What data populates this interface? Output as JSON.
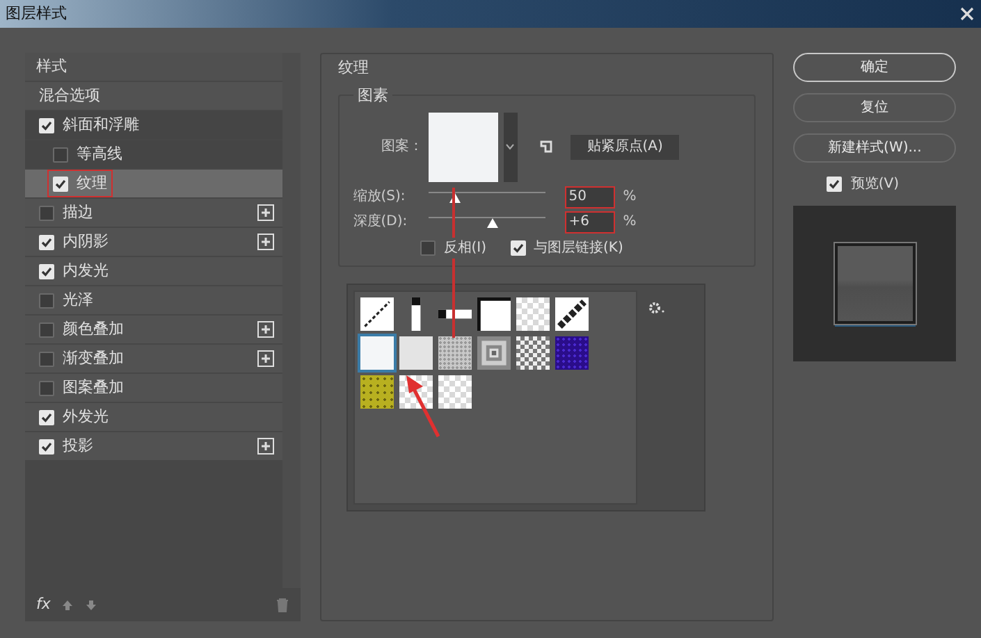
{
  "window": {
    "title": "图层样式"
  },
  "styles_panel": {
    "heading": "样式",
    "items": [
      {
        "kind": "option",
        "label": "混合选项",
        "selected": false,
        "highlighted": false
      },
      {
        "kind": "effect",
        "label": "斜面和浮雕",
        "checked": true,
        "has_add": false,
        "selected": false,
        "highlighted": false,
        "children": [
          {
            "kind": "effect",
            "label": "等高线",
            "checked": false,
            "has_add": false,
            "selected": false,
            "highlighted": false
          },
          {
            "kind": "effect",
            "label": "纹理",
            "checked": true,
            "has_add": false,
            "selected": true,
            "highlighted": true
          }
        ]
      },
      {
        "kind": "effect",
        "label": "描边",
        "checked": false,
        "has_add": true,
        "selected": false,
        "highlighted": false
      },
      {
        "kind": "effect",
        "label": "内阴影",
        "checked": true,
        "has_add": true,
        "selected": false,
        "highlighted": false
      },
      {
        "kind": "effect",
        "label": "内发光",
        "checked": true,
        "has_add": false,
        "selected": false,
        "highlighted": false
      },
      {
        "kind": "effect",
        "label": "光泽",
        "checked": false,
        "has_add": false,
        "selected": false,
        "highlighted": false
      },
      {
        "kind": "effect",
        "label": "颜色叠加",
        "checked": false,
        "has_add": true,
        "selected": false,
        "highlighted": false
      },
      {
        "kind": "effect",
        "label": "渐变叠加",
        "checked": false,
        "has_add": true,
        "selected": false,
        "highlighted": false
      },
      {
        "kind": "effect",
        "label": "图案叠加",
        "checked": false,
        "has_add": false,
        "selected": false,
        "highlighted": false
      },
      {
        "kind": "effect",
        "label": "外发光",
        "checked": true,
        "has_add": false,
        "selected": false,
        "highlighted": false
      },
      {
        "kind": "effect",
        "label": "投影",
        "checked": true,
        "has_add": true,
        "selected": false,
        "highlighted": false
      }
    ]
  },
  "texture": {
    "title": "纹理",
    "group_title": "图素",
    "pattern_label": "图案：",
    "snap_button": "贴紧原点(A)",
    "sliders": [
      {
        "label": "缩放(S):",
        "level": 0.23,
        "value": "50",
        "unit": "%",
        "highlighted": true
      },
      {
        "label": "深度(D):",
        "level": 0.55,
        "value": "+6",
        "unit": "%",
        "highlighted": true
      }
    ],
    "options": [
      {
        "label": "反相(I)",
        "checked": false
      },
      {
        "label": "与图层链接(K)",
        "checked": true
      }
    ],
    "patterns": [
      {
        "kind": "diagonal",
        "selected": false
      },
      {
        "kind": "bar-vertical",
        "selected": false
      },
      {
        "kind": "bar-horizontal",
        "selected": false
      },
      {
        "kind": "frame",
        "selected": false
      },
      {
        "kind": "checker",
        "selected": false
      },
      {
        "kind": "diagonal-thick",
        "selected": false
      },
      {
        "kind": "white",
        "selected": true
      },
      {
        "kind": "light",
        "selected": false
      },
      {
        "kind": "noise",
        "selected": false
      },
      {
        "kind": "concentric",
        "selected": false
      },
      {
        "kind": "marble",
        "selected": false
      },
      {
        "kind": "blue",
        "selected": false
      },
      {
        "kind": "yellow",
        "selected": false
      },
      {
        "kind": "checker",
        "selected": false
      },
      {
        "kind": "checker",
        "selected": false
      }
    ]
  },
  "buttons": [
    {
      "label": "确定",
      "default": true
    },
    {
      "label": "复位",
      "default": false
    },
    {
      "label": "新建样式(W)...",
      "default": false
    }
  ],
  "preview": {
    "label": "预览(V)",
    "checked": true
  },
  "footer": {
    "fx_label": "fx"
  }
}
